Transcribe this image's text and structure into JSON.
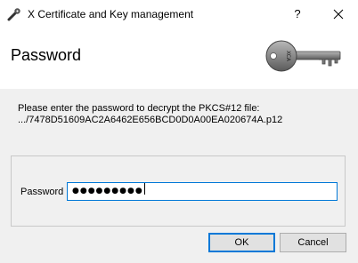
{
  "window": {
    "title": "X Certificate and Key management",
    "help_label": "?"
  },
  "header": {
    "title": "Password"
  },
  "content": {
    "description_line1": "Please enter the password to decrypt the PKCS#12 file:",
    "description_line2": ".../7478D51609AC2A6462E656BCD0D0A00EA020674A.p12"
  },
  "form": {
    "password_label": "Password",
    "password_masked": "●●●●●●●●●"
  },
  "buttons": {
    "ok_label": "OK",
    "cancel_label": "Cancel"
  },
  "icons": {
    "app": "key-pen-icon",
    "close": "close-icon",
    "header": "key-icon"
  },
  "colors": {
    "accent": "#0078d7",
    "header_bg": "#ffffff",
    "dialog_bg": "#f0f0f0"
  }
}
